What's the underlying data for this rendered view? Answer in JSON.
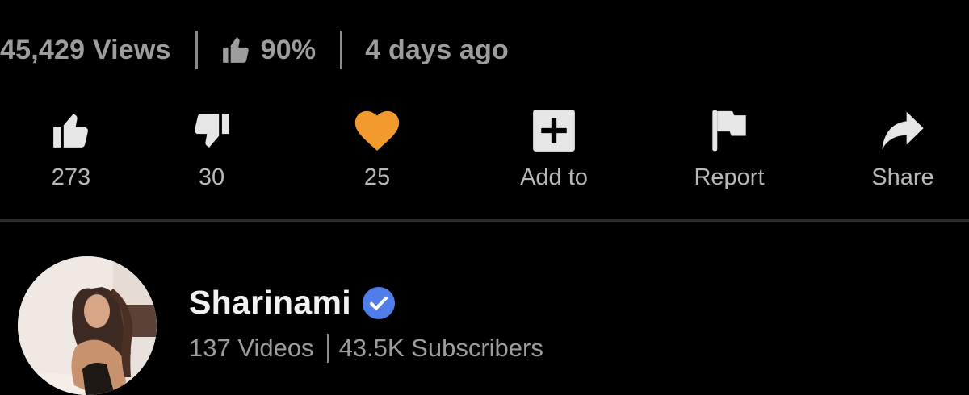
{
  "stats": {
    "views": "45,429 Views",
    "rating": "90%",
    "age": "4 days ago"
  },
  "actions": [
    {
      "id": "like",
      "label": "273",
      "icon": "thumbs-up-icon"
    },
    {
      "id": "dislike",
      "label": "30",
      "icon": "thumbs-down-icon"
    },
    {
      "id": "favorite",
      "label": "25",
      "icon": "heart-icon"
    },
    {
      "id": "add",
      "label": "Add to",
      "icon": "plus-square-icon"
    },
    {
      "id": "report",
      "label": "Report",
      "icon": "flag-icon"
    },
    {
      "id": "share",
      "label": "Share",
      "icon": "share-arrow-icon"
    }
  ],
  "channel": {
    "name": "Sharinami",
    "verified": true,
    "videos": "137 Videos",
    "subscribers": "43.5K Subscribers"
  },
  "colors": {
    "background": "#000000",
    "heart": "#f39a2e",
    "verified_badge": "#4f7ee8",
    "icon": "#e6e6e6",
    "muted_text": "#9d9d9d"
  }
}
